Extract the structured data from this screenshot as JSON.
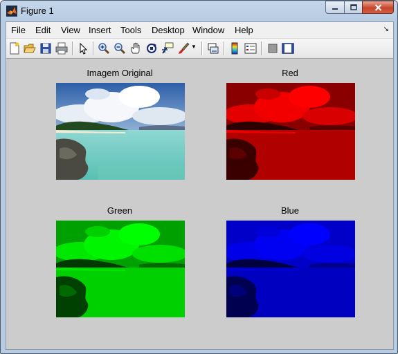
{
  "window": {
    "title": "Figure 1"
  },
  "menu": [
    "File",
    "Edit",
    "View",
    "Insert",
    "Tools",
    "Desktop",
    "Window",
    "Help"
  ],
  "toolbar": {
    "icons": [
      "new-figure-icon",
      "open-file-icon",
      "save-icon",
      "print-icon",
      "pointer-icon",
      "zoom-in-icon",
      "zoom-out-icon",
      "pan-icon",
      "rotate-3d-icon",
      "data-cursor-icon",
      "brush-icon",
      "brush-dropdown-icon",
      "link-plot-icon",
      "colorbar-icon",
      "legend-icon",
      "hide-plot-tools-icon",
      "show-plot-tools-icon"
    ]
  },
  "panels": [
    {
      "title": "Imagem Original",
      "channel": "original"
    },
    {
      "title": "Red",
      "channel": "red"
    },
    {
      "title": "Green",
      "channel": "green"
    },
    {
      "title": "Blue",
      "channel": "blue"
    }
  ],
  "colors": {
    "red": "#ff0000",
    "green": "#00ff00",
    "blue": "#0000ff",
    "background": "#cccccc"
  }
}
